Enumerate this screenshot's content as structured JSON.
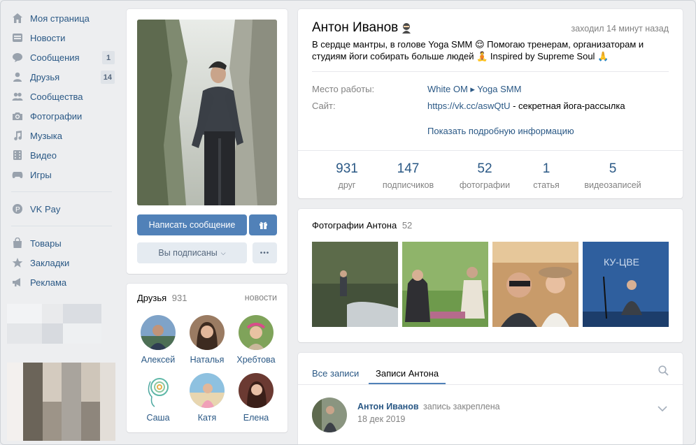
{
  "nav": {
    "items": [
      {
        "label": "Моя страница",
        "icon": "home-icon"
      },
      {
        "label": "Новости",
        "icon": "news-icon"
      },
      {
        "label": "Сообщения",
        "icon": "messages-icon",
        "count": "1"
      },
      {
        "label": "Друзья",
        "icon": "friends-icon",
        "count": "14"
      },
      {
        "label": "Сообщества",
        "icon": "groups-icon"
      },
      {
        "label": "Фотографии",
        "icon": "camera-icon"
      },
      {
        "label": "Музыка",
        "icon": "music-icon"
      },
      {
        "label": "Видео",
        "icon": "video-icon"
      },
      {
        "label": "Игры",
        "icon": "games-icon"
      }
    ],
    "pay": {
      "label": "VK Pay",
      "icon": "vkpay-icon"
    },
    "extra": [
      {
        "label": "Товары",
        "icon": "bag-icon"
      },
      {
        "label": "Закладки",
        "icon": "star-icon"
      },
      {
        "label": "Реклама",
        "icon": "megaphone-icon"
      }
    ]
  },
  "profile": {
    "name": "Антон Иванов",
    "last_seen": "заходил 14 минут назад",
    "status_line1": "В сердце мантры, в голове Yoga SMM 😌 Помогаю тренерам, организаторам и",
    "status_line2": "студиям йоги собирать больше людей 🧘 Inspired by Supreme Soul 🙏",
    "work_label": "Место работы:",
    "work_value": "White OM ▸ Yoga SMM",
    "site_label": "Сайт:",
    "site_link": "https://vk.cc/aswQtU",
    "site_suffix": " - секретная йога-рассылка",
    "more_info": "Показать подробную информацию",
    "counters": [
      {
        "num": "931",
        "cap": "друг"
      },
      {
        "num": "147",
        "cap": "подписчиков"
      },
      {
        "num": "52",
        "cap": "фотографии"
      },
      {
        "num": "1",
        "cap": "статья"
      },
      {
        "num": "5",
        "cap": "видеозаписей"
      }
    ]
  },
  "actions": {
    "message": "Написать сообщение",
    "subscribed": "Вы подписаны",
    "more": "•••"
  },
  "friends": {
    "title": "Друзья",
    "count": "931",
    "news_link": "новости",
    "list": [
      {
        "name": "Алексей"
      },
      {
        "name": "Наталья"
      },
      {
        "name": "Хребтова"
      },
      {
        "name": "Саша"
      },
      {
        "name": "Катя"
      },
      {
        "name": "Елена"
      }
    ]
  },
  "photos": {
    "title": "Фотографии Антона",
    "count": "52"
  },
  "wall": {
    "tab_all": "Все записи",
    "tab_own": "Записи Антона",
    "post_author": "Антон Иванов",
    "post_action": "запись закреплена",
    "post_date": "18 дек 2019"
  }
}
